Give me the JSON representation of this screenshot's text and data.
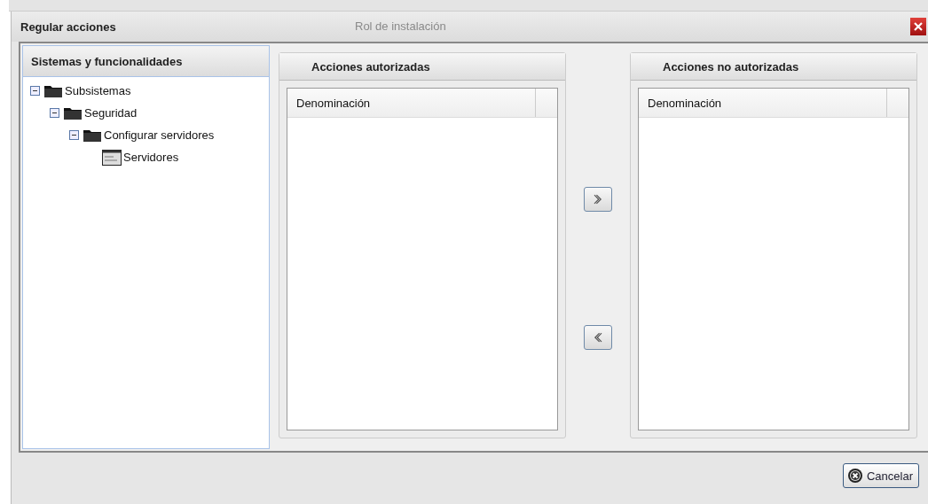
{
  "background": {
    "text": "Rol de instalación"
  },
  "window": {
    "title": "Regular acciones"
  },
  "tree_panel": {
    "title": "Sistemas y funcionalidades",
    "items": [
      {
        "label": "Subsistemas",
        "kind": "folder",
        "expanded": true,
        "children": [
          {
            "label": "Seguridad",
            "kind": "folder",
            "expanded": true,
            "children": [
              {
                "label": "Configurar servidores",
                "kind": "folder",
                "expanded": true,
                "children": [
                  {
                    "label": "Servidores",
                    "kind": "form"
                  }
                ]
              }
            ]
          }
        ]
      }
    ]
  },
  "authorized_panel": {
    "title": "Acciones autorizadas",
    "columns": [
      "Denominación"
    ]
  },
  "transfer_buttons": [
    {
      "kind": "right"
    },
    {
      "kind": "left"
    }
  ],
  "unauthorized_panel": {
    "title": "Acciones no autorizadas",
    "columns": [
      "Denominación"
    ]
  },
  "buttons": [
    {
      "label": "Cancelar"
    }
  ]
}
